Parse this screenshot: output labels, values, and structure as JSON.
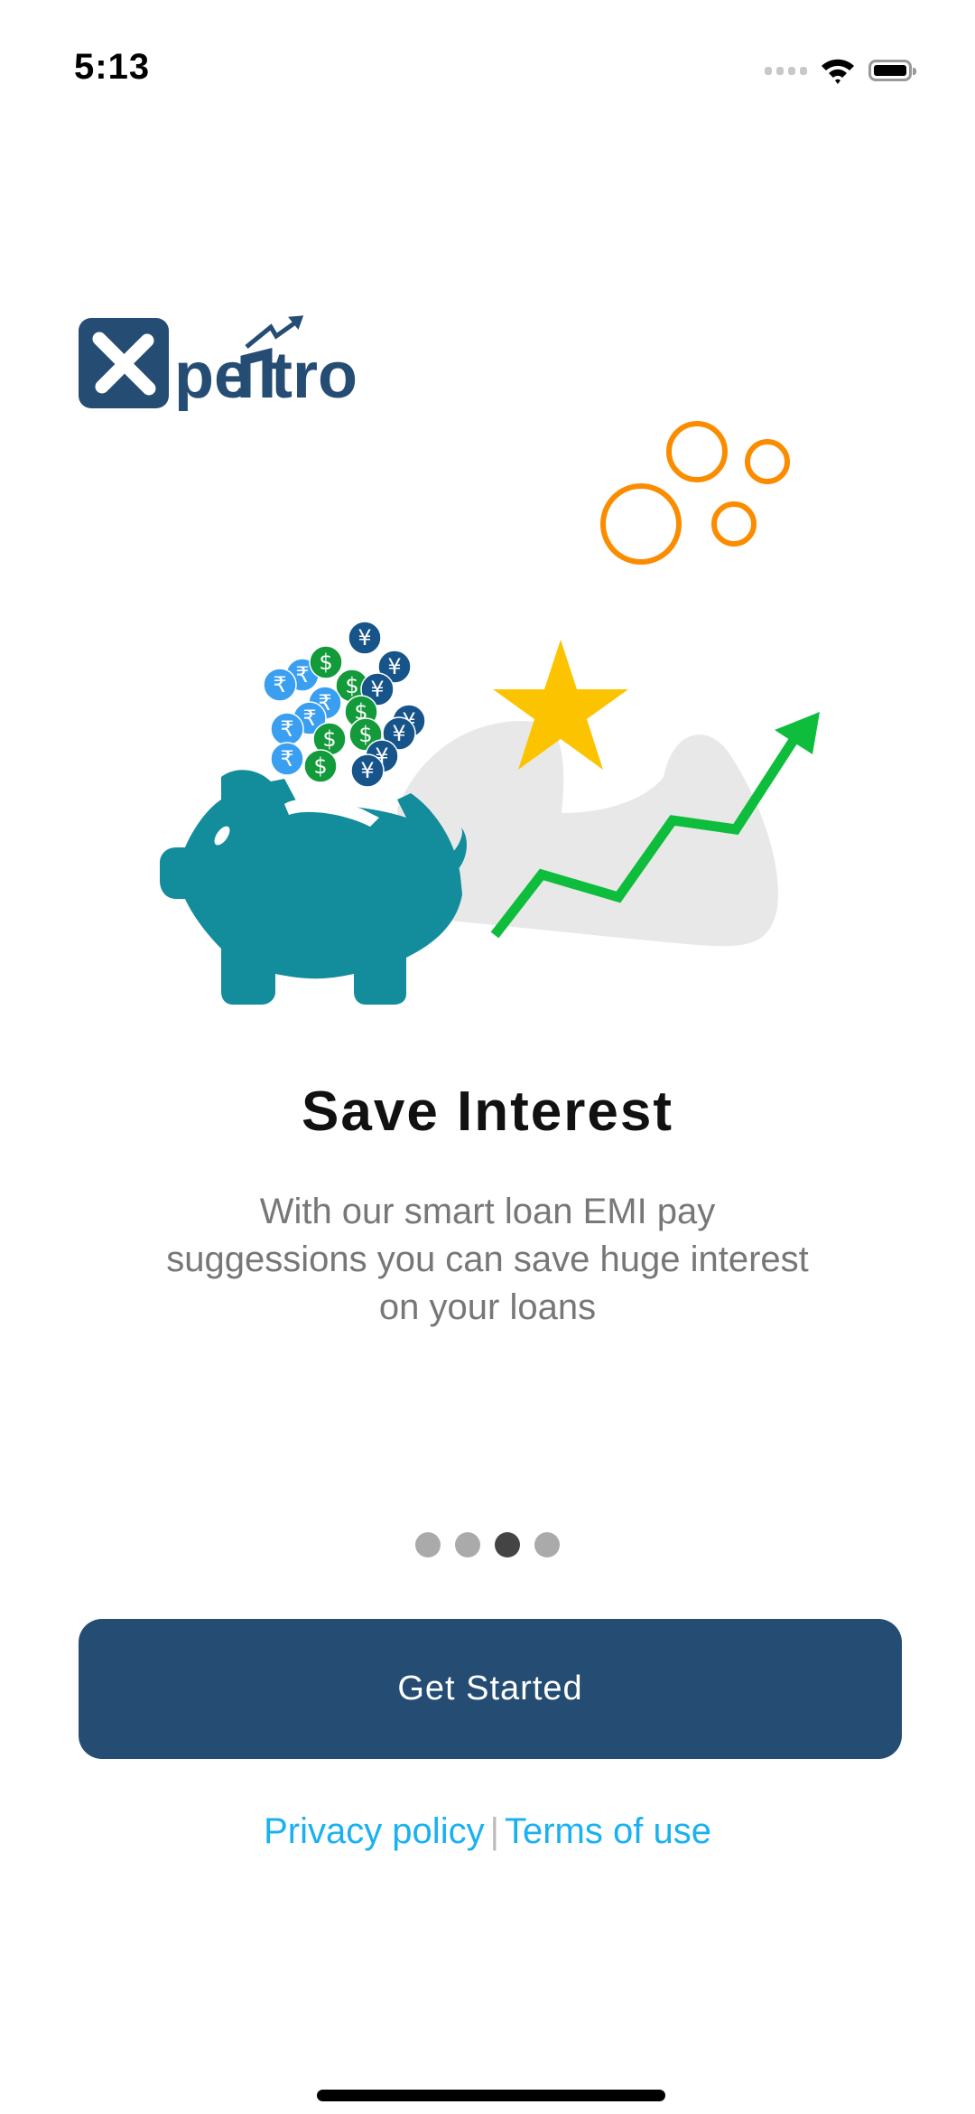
{
  "status_bar": {
    "time": "5:13"
  },
  "logo": {
    "text": "Xpentro"
  },
  "onboarding": {
    "title": "Save Interest",
    "description": "With our smart loan EMI pay suggessions you can save huge interest on your loans",
    "page_count": 4,
    "active_page": 3
  },
  "actions": {
    "get_started": "Get Started"
  },
  "footer": {
    "privacy": "Privacy policy",
    "separator": "|",
    "terms": "Terms of use"
  },
  "colors": {
    "brand": "#254d73",
    "link": "#1ab1f0",
    "pig": "#138c9c",
    "star": "#fcc400",
    "arrow": "#0ebd3b",
    "bubbles": "#fb8c00"
  }
}
